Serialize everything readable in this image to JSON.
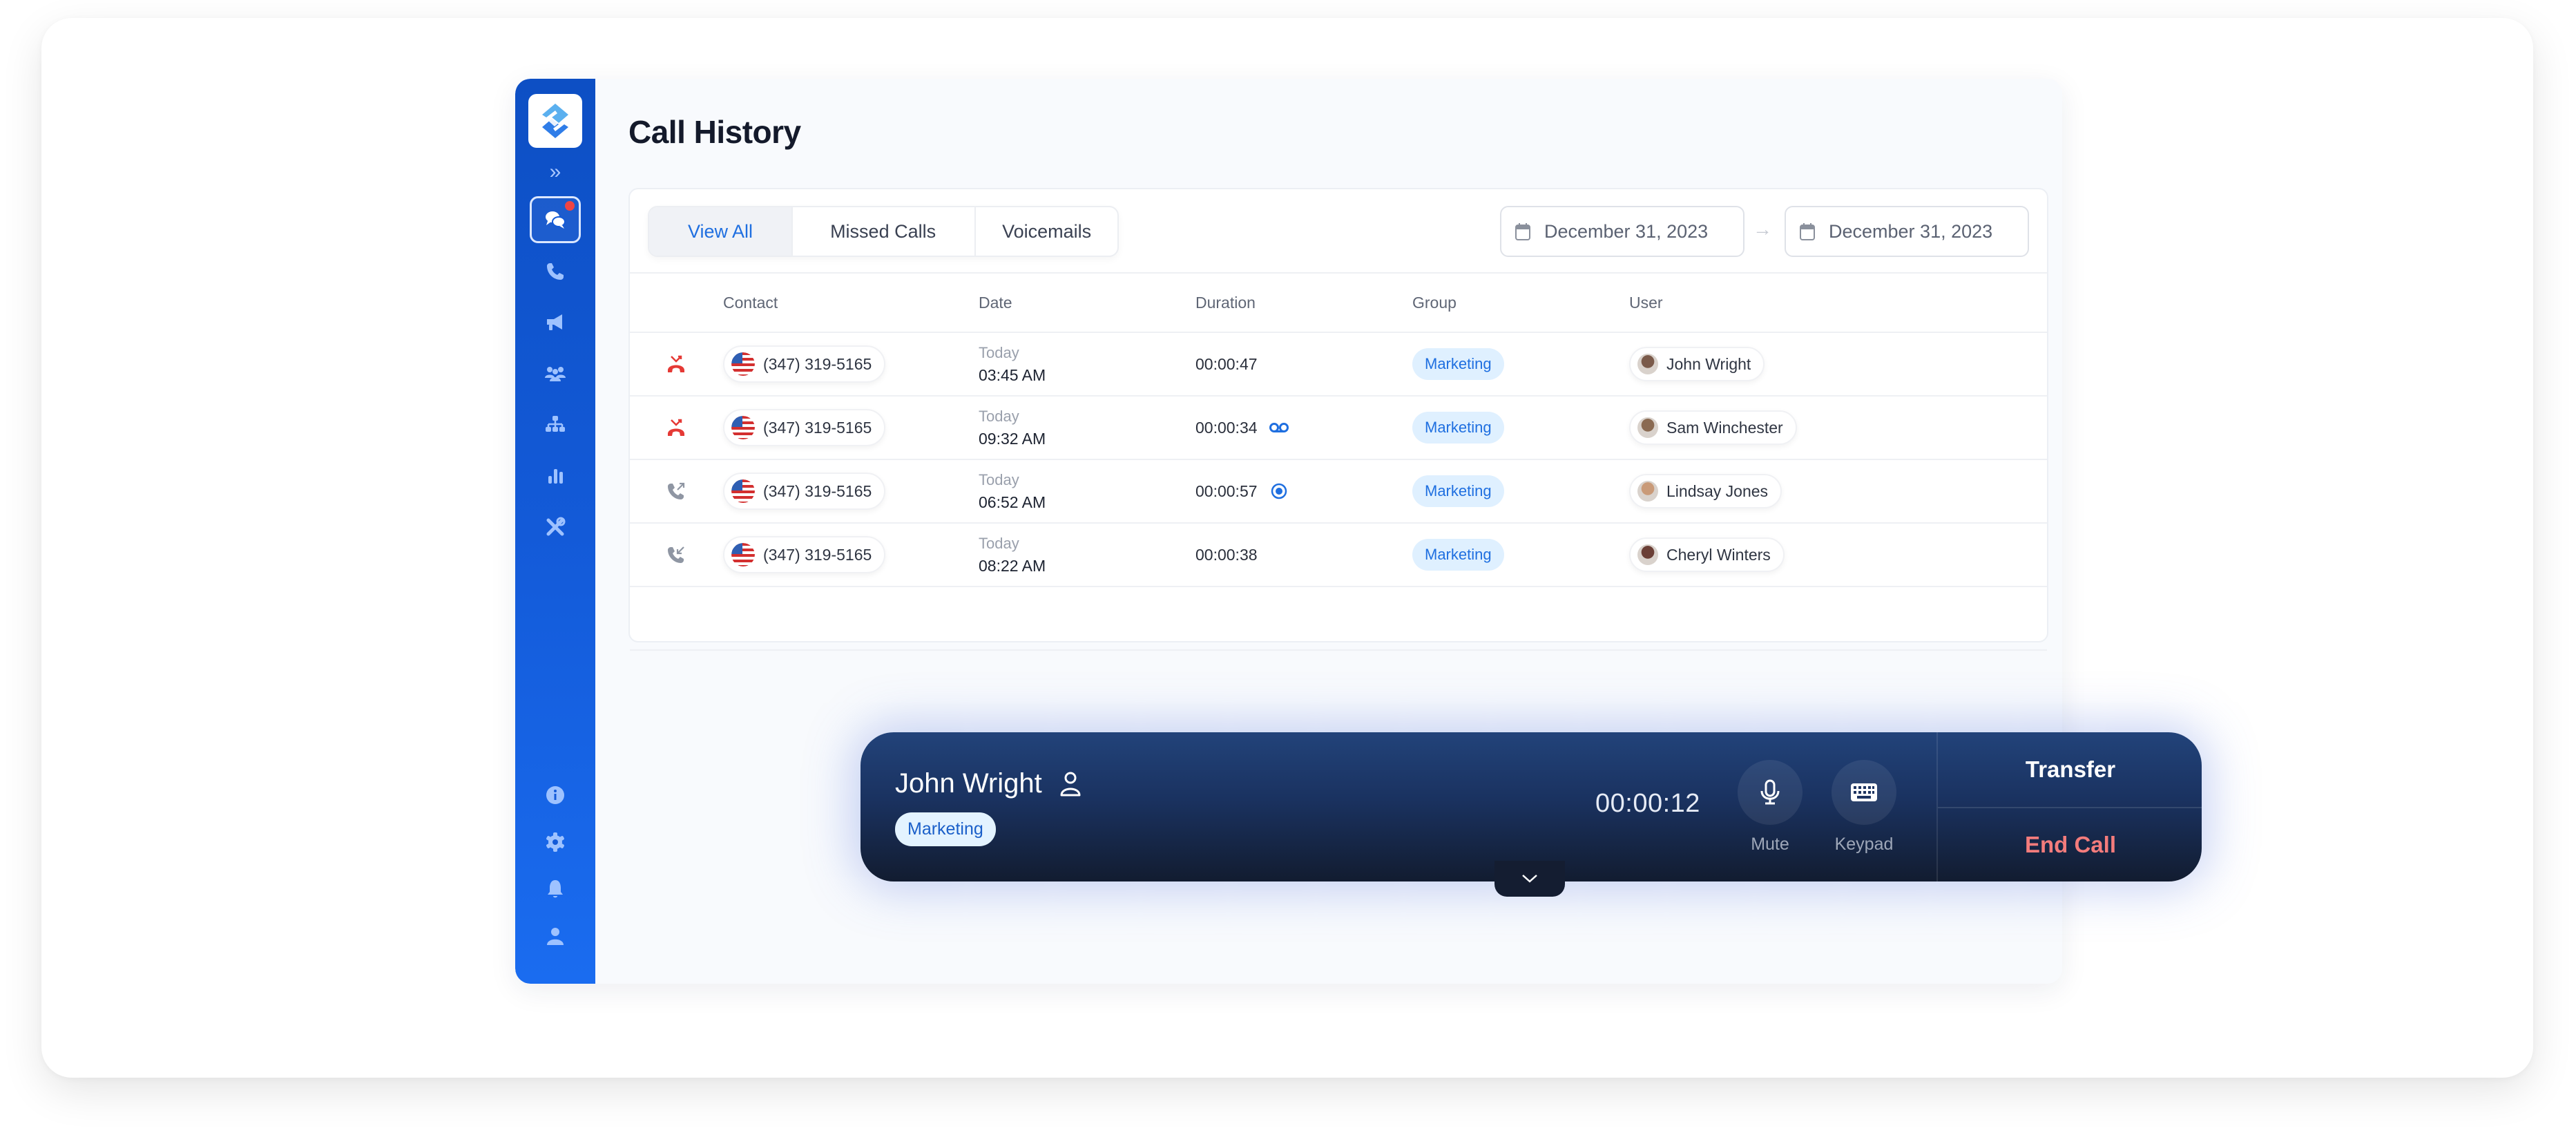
{
  "app": {
    "logo": "app-logo",
    "sidebar": {
      "expand_icon": "double-chevron-right-icon",
      "items": [
        {
          "name": "messages",
          "icon": "chat-bubbles-icon",
          "active": true,
          "notification": true
        },
        {
          "name": "calls",
          "icon": "phone-icon",
          "active": false
        },
        {
          "name": "campaigns",
          "icon": "megaphone-icon",
          "active": false
        },
        {
          "name": "contacts",
          "icon": "users-icon",
          "active": false
        },
        {
          "name": "organization",
          "icon": "sitemap-icon",
          "active": false
        },
        {
          "name": "reports",
          "icon": "bar-chart-icon",
          "active": false
        },
        {
          "name": "tools",
          "icon": "tools-icon",
          "active": false
        }
      ],
      "bottom_items": [
        {
          "name": "info",
          "icon": "info-icon"
        },
        {
          "name": "settings",
          "icon": "gear-icon"
        },
        {
          "name": "notifications",
          "icon": "bell-icon"
        },
        {
          "name": "profile",
          "icon": "user-icon"
        }
      ]
    }
  },
  "page": {
    "title": "Call History",
    "tabs": [
      {
        "label": "View All",
        "active": true
      },
      {
        "label": "Missed Calls",
        "active": false
      },
      {
        "label": "Voicemails",
        "active": false
      }
    ],
    "date_from": "December 31, 2023",
    "date_to": "December 31, 2023"
  },
  "table": {
    "columns": [
      "Contact",
      "Date",
      "Duration",
      "Group",
      "User"
    ],
    "rows": [
      {
        "direction": "missed",
        "contact": "(347) 319-5165",
        "day": "Today",
        "time": "03:45 AM",
        "duration": "00:00:47",
        "extra": "",
        "group": "Marketing",
        "user": "John Wright",
        "avatar_color": "#7a5a4a"
      },
      {
        "direction": "missed",
        "contact": "(347) 319-5165",
        "day": "Today",
        "time": "09:32 AM",
        "duration": "00:00:34",
        "extra": "voicemail",
        "group": "Marketing",
        "user": "Sam Winchester",
        "avatar_color": "#8a6a52"
      },
      {
        "direction": "outgoing",
        "contact": "(347) 319-5165",
        "day": "Today",
        "time": "06:52 AM",
        "duration": "00:00:57",
        "extra": "recording",
        "group": "Marketing",
        "user": "Lindsay Jones",
        "avatar_color": "#c99a78"
      },
      {
        "direction": "incoming",
        "contact": "(347) 319-5165",
        "day": "Today",
        "time": "08:22 AM",
        "duration": "00:00:38",
        "extra": "",
        "group": "Marketing",
        "user": "Cheryl Winters",
        "avatar_color": "#6b3f36"
      }
    ]
  },
  "active_call": {
    "caller_name": "John Wright",
    "caller_group": "Marketing",
    "timer": "00:00:12",
    "mute_label": "Mute",
    "keypad_label": "Keypad",
    "transfer_label": "Transfer",
    "end_call_label": "End Call"
  },
  "colors": {
    "accent": "#1f6fe0",
    "sidebar": "#135ad8",
    "missed": "#e53935",
    "end_call": "#f47c7c",
    "group_badge_bg": "#dff0ff"
  }
}
